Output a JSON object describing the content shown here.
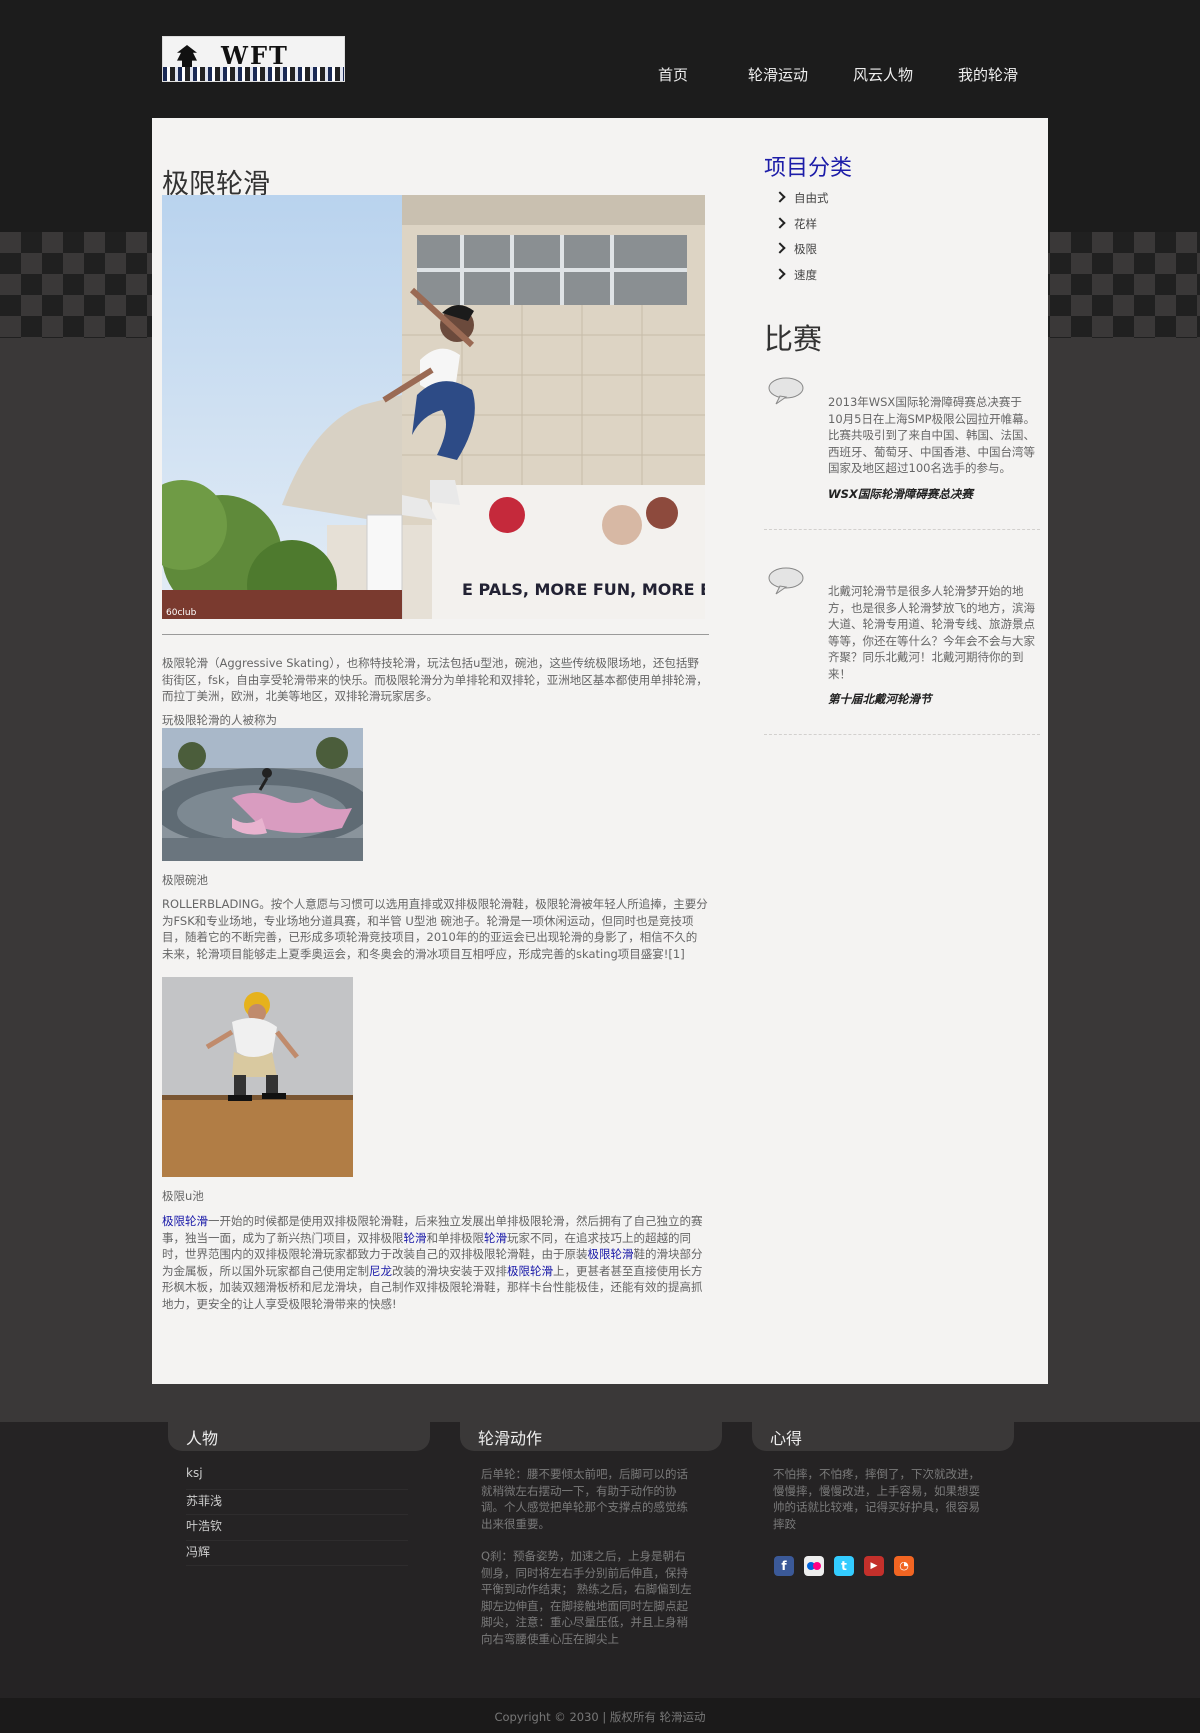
{
  "nav": {
    "items": [
      "首页",
      "轮滑运动",
      "风云人物",
      "我的轮滑"
    ]
  },
  "main": {
    "title": "极限轮滑",
    "paragraph1": "极限轮滑（Aggressive Skating），也称特技轮滑，玩法包括u型池，碗池，这些传统极限场地，还包括野街街区，fsk，自由享受轮滑带来的快乐。而极限轮滑分为单排轮和双排轮，亚洲地区基本都使用单排轮滑，而拉丁美洲，欧洲，北美等地区，双排轮滑玩家居多。",
    "lead": "玩极限轮滑的人被称为",
    "caption_bowl": "极限碗池",
    "paragraph2": "ROLLERBLADING。按个人意愿与习惯可以选用直排或双排极限轮滑鞋，极限轮滑被年轻人所追捧，主要分为FSK和专业场地，专业场地分道具赛，和半管 U型池 碗池子。轮滑是一项休闲运动，但同时也是竞技项目，随着它的不断完善，已形成多项轮滑竞技项目，2010年的的亚运会已出现轮滑的身影了，相信不久的未来，轮滑项目能够走上夏季奥运会，和冬奥会的滑冰项目互相呼应，形成完善的skating项目盛宴![1]",
    "caption_upool": "极限u池",
    "p3": {
      "s1": "极限轮滑",
      "s2": "一开始的时候都是使用双排极限轮滑鞋，后来独立发展出单排极限轮滑，然后拥有了自己独立的赛事，独当一面，成为了新兴热门项目，双排极限",
      "s3": "轮滑",
      "s4": "和单排极限",
      "s5": "轮滑",
      "s6": "玩家不同，在追求技巧上的超越的同时，世界范围内的双排极限轮滑玩家都致力于改装自己的双排极限轮滑鞋，由于原装",
      "s7": "极限轮滑",
      "s8": "鞋的滑块部分为金属板，所以国外玩家都自己使用定制",
      "s9": "尼龙",
      "s10": "改装的滑块安装于双排",
      "s11": "极限轮滑",
      "s12": "上，更甚者甚至直接使用长方形枫木板，加装双翘滑板桥和尼龙滑块，自己制作双排极限轮滑鞋，那样卡台性能极佳，还能有效的提高抓地力，更安全的让人享受极限轮滑带来的快感!"
    }
  },
  "sidebar": {
    "categories_title": "项目分类",
    "categories": [
      "自由式",
      "花样",
      "极限",
      "速度"
    ],
    "match_title": "比赛",
    "events": [
      {
        "text": "2013年WSX国际轮滑障碍赛总决赛于10月5日在上海SMP极限公园拉开帷幕。比赛共吸引到了来自中国、韩国、法国、西班牙、葡萄牙、中国香港、中国台湾等国家及地区超过100名选手的参与。",
        "title": "WSX国际轮滑障碍赛总决赛"
      },
      {
        "text": "北戴河轮滑节是很多人轮滑梦开始的地方，也是很多人轮滑梦放飞的地方，滨海大道、轮滑专用道、轮滑专线、旅游景点等等，你还在等什么？今年会不会与大家齐聚？同乐北戴河！北戴河期待你的到来！",
        "title": "第十届北戴河轮滑节"
      }
    ]
  },
  "footer": {
    "people_title": "人物",
    "people": [
      "ksj",
      "苏菲浅",
      "叶浩钦",
      "冯辉"
    ],
    "moves_title": "轮滑动作",
    "moves_text1": "后单轮：腰不要倾太前吧，后脚可以的话就稍微左右摆动一下，有助于动作的协调。个人感觉把单轮那个支撑点的感觉练出来很重要。",
    "moves_text2": "Q刹：预备姿势，加速之后，上身是朝右侧身，同时将左右手分别前后伸直，保持平衡到动作结束； 熟练之后，右脚偏到左脚左边伸直，在脚接触地面同时左脚点起脚尖，注意：重心尽量压低，并且上身稍向右弯腰使重心压在脚尖上",
    "thoughts_title": "心得",
    "thoughts_text": "不怕摔，不怕疼，摔倒了，下次就改进，慢慢摔，慢慢改进，上手容易，如果想耍帅的话就比较难，记得买好护具，很容易摔跤",
    "social_icons": [
      "facebook-icon",
      "flickr-icon",
      "twitter-icon",
      "youtube-icon",
      "rss-icon"
    ],
    "copyright": "Copyright © 2030 | 版权所有 轮滑运动"
  },
  "colors": {
    "dark_bg": "#1c1c1c",
    "mid_bg": "#3a3838",
    "panel": "#f4f3f2",
    "accent_blue": "#1818a8"
  }
}
